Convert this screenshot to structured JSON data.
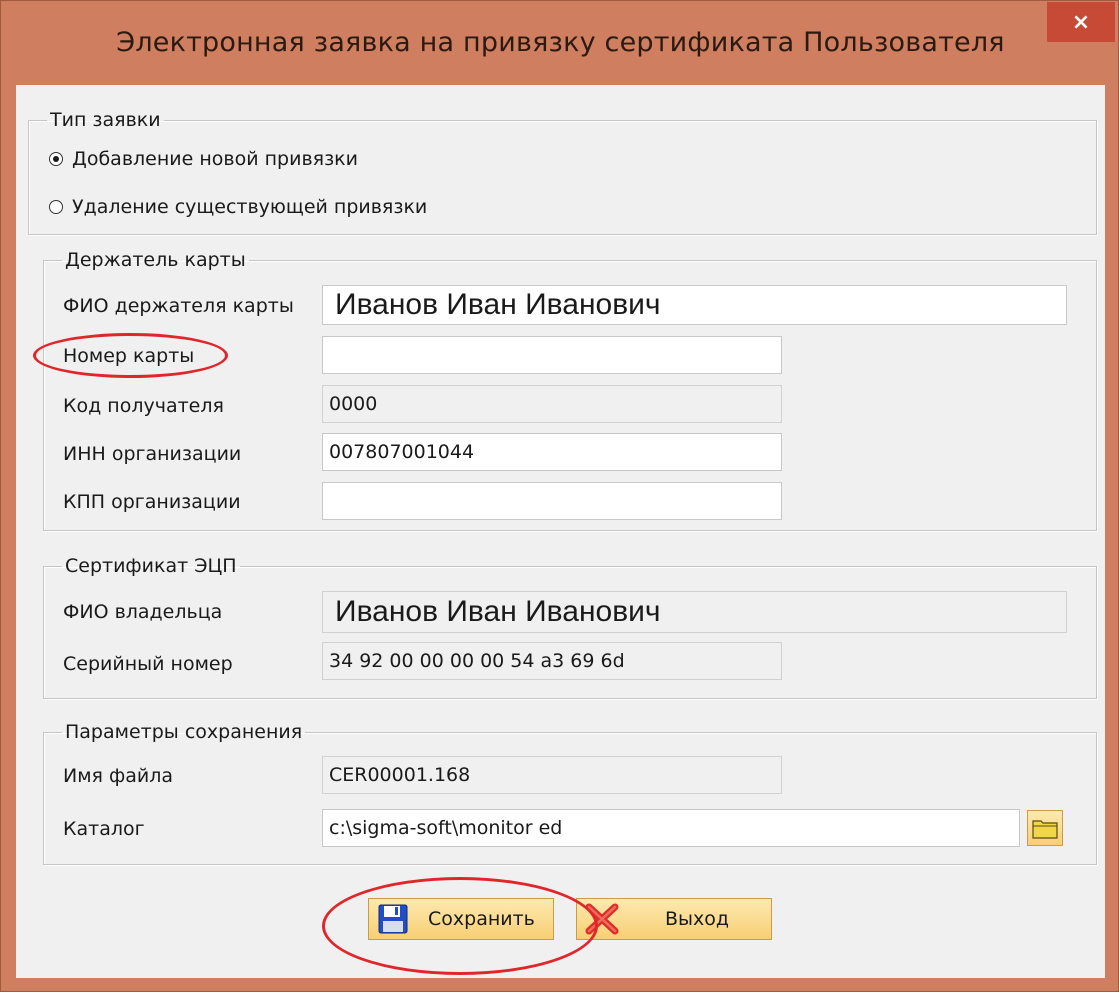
{
  "window": {
    "title": "Электронная заявка на привязку сертификата Пользователя",
    "close_glyph": "×"
  },
  "request_type": {
    "legend": "Тип заявки",
    "options": [
      {
        "label": "Добавление новой привязки",
        "selected": true
      },
      {
        "label": "Удаление существующей привязки",
        "selected": false
      }
    ]
  },
  "card_holder": {
    "legend": "Держатель карты",
    "holder_name_label": "ФИО держателя карты",
    "holder_name_value": "Иванов Иван Иванович",
    "card_number_label": "Номер карты",
    "card_number_value": "",
    "recipient_code_label": "Код получателя",
    "recipient_code_value": "0000",
    "inn_label": "ИНН организации",
    "inn_value": "007807001044",
    "kpp_label": "КПП организации",
    "kpp_value": ""
  },
  "certificate": {
    "legend": "Сертификат ЭЦП",
    "owner_label": "ФИО владельца",
    "owner_value": "Иванов Иван Иванович",
    "serial_label": "Серийный номер",
    "serial_value": "34 92 00 00 00 00 54 a3 69 6d"
  },
  "save_params": {
    "legend": "Параметры сохранения",
    "filename_label": "Имя файла",
    "filename_value": "CER00001.168",
    "directory_label": "Каталог",
    "directory_value": "c:\\sigma-soft\\monitor ed"
  },
  "buttons": {
    "save_label": "Сохранить",
    "exit_label": "Выход"
  },
  "colors": {
    "annotation": "#e0262b",
    "title_bar": "#cf7f5f",
    "close_button": "#c74a37",
    "button_fill": "#f8cf74"
  }
}
